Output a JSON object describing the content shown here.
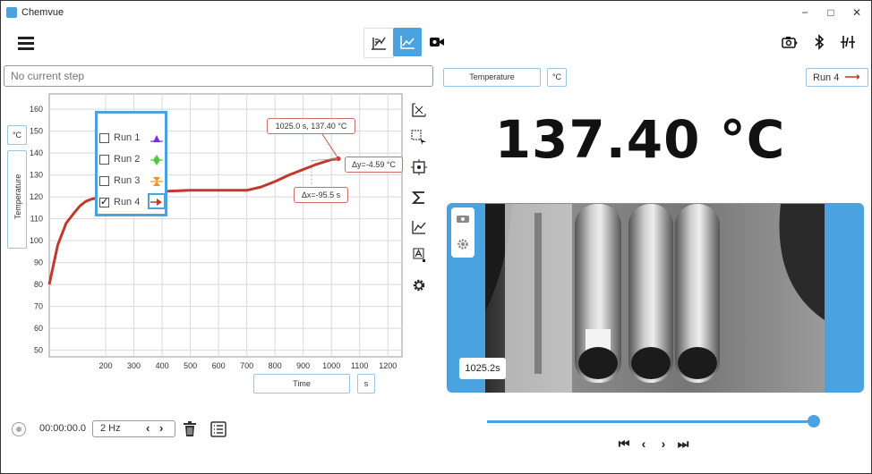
{
  "app": {
    "title": "Chemvue"
  },
  "window_controls": {
    "minimize": "−",
    "maximize": "□",
    "close": "✕"
  },
  "toolbar": {
    "modes": [
      {
        "name": "table-view",
        "icon": "table-line-icon",
        "active": false
      },
      {
        "name": "graph-view",
        "icon": "line-graph-icon",
        "active": true
      },
      {
        "name": "camera-view",
        "icon": "video-camera-icon",
        "active": false
      }
    ],
    "right_icons": [
      "camera-snapshot-icon",
      "bluetooth-icon",
      "sensor-connect-icon"
    ]
  },
  "step": {
    "placeholder": "No current step"
  },
  "graph": {
    "y_unit": "°C",
    "y_label": "Temperature",
    "x_label": "Time",
    "x_unit": "s",
    "legend": [
      {
        "label": "Run 1",
        "checked": false,
        "color": "#7b2fd8",
        "marker": "triangle-up"
      },
      {
        "label": "Run 2",
        "checked": false,
        "color": "#4ccc3a",
        "marker": "diamond"
      },
      {
        "label": "Run 3",
        "checked": false,
        "color": "#f2922b",
        "marker": "hourglass"
      },
      {
        "label": "Run 4",
        "checked": true,
        "check_mark": "✓",
        "color": "#c0392b",
        "marker": "arrow-right"
      }
    ],
    "annotations": {
      "point": "1025.0 s, 137.40 °C",
      "dy": "Δy=-4.59 °C",
      "dx": "Δx=-95.5 s"
    }
  },
  "chart_data": {
    "type": "line",
    "xlabel": "Time",
    "ylabel": "Temperature",
    "xlim": [
      0,
      1250
    ],
    "ylim": [
      47,
      167
    ],
    "x_ticks": [
      200,
      300,
      400,
      500,
      600,
      700,
      800,
      900,
      1000,
      1100,
      1200
    ],
    "y_ticks": [
      50,
      60,
      70,
      80,
      90,
      100,
      110,
      120,
      130,
      140,
      150,
      160
    ],
    "grid": true,
    "legend_placement": "top-left",
    "series": [
      {
        "name": "Run 4",
        "color": "#c0392b",
        "x": [
          0,
          30,
          60,
          90,
          110,
          130,
          150,
          170,
          200,
          230,
          260,
          300,
          400,
          500,
          600,
          650,
          700,
          750,
          800,
          850,
          900,
          950,
          1000,
          1025
        ],
        "y": [
          80,
          98,
          108,
          113,
          116,
          118,
          119,
          119.5,
          120,
          120.3,
          120.7,
          121.5,
          122.5,
          123,
          123,
          123,
          123,
          124.5,
          127,
          130,
          132.5,
          135,
          137,
          137.4
        ]
      }
    ]
  },
  "display": {
    "measure_button": "Temperature",
    "unit_button": "°C",
    "run_select": "Run 4",
    "run_arrow": "⟶",
    "value": "137.40 °C"
  },
  "camera": {
    "timestamp": "1025.2s"
  },
  "playback": {
    "position": 1.0,
    "first": "⏮",
    "prev": "‹",
    "next": "›",
    "last": "⏭"
  },
  "recording": {
    "timer": "00:00:00.0",
    "rate": "2 Hz",
    "rate_prev": "‹",
    "rate_next": "›"
  },
  "colors": {
    "accent": "#4aa3df",
    "series": "#c0392b",
    "annotation_border": "#d06b6b"
  }
}
